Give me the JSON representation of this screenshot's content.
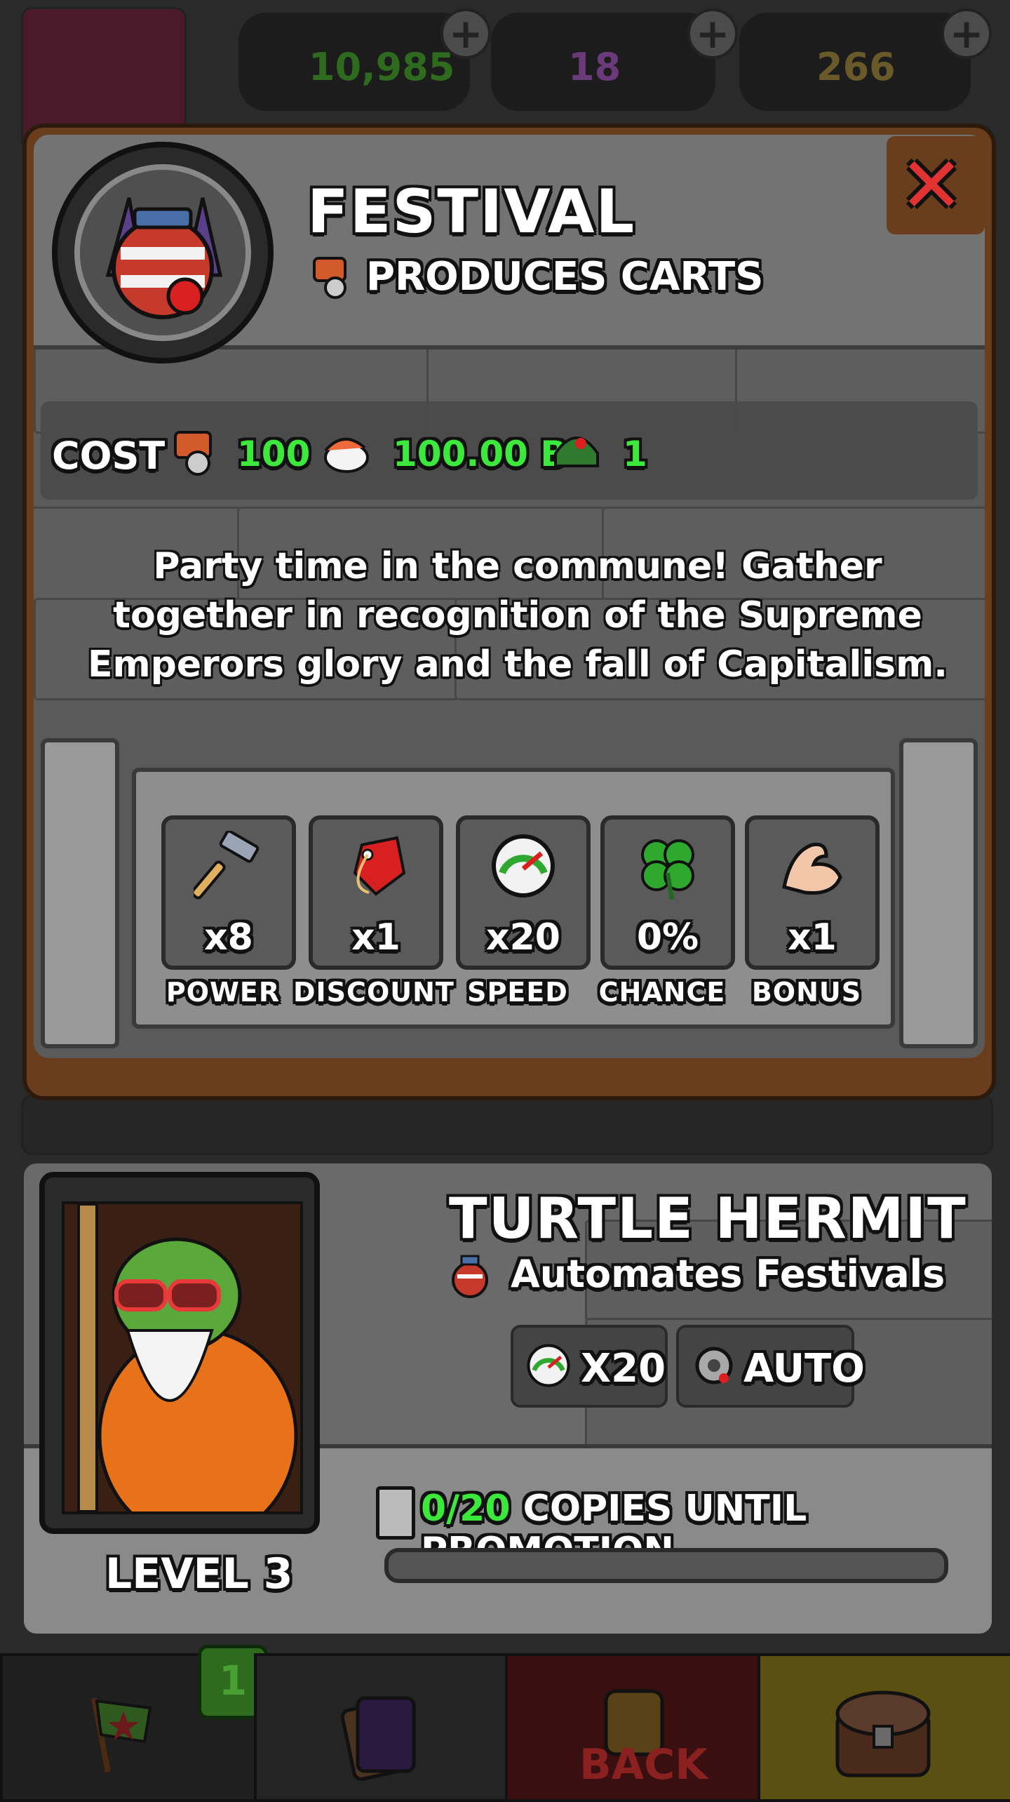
{
  "topbar": {
    "resources": [
      {
        "value": "10,985",
        "icon": "cash-icon",
        "color": "#2f6b1f"
      },
      {
        "value": "18",
        "icon": "potion-icon",
        "color": "#6a3a7a"
      },
      {
        "value": "266",
        "icon": "gold-bar-icon",
        "color": "#6a5a2a"
      }
    ]
  },
  "building": {
    "title": "FESTIVAL",
    "subtitle": "PRODUCES CARTS",
    "cost_label": "COST",
    "costs": [
      {
        "icon": "cart-icon",
        "value": "100"
      },
      {
        "icon": "sushi-icon",
        "value": "100.00 B"
      },
      {
        "icon": "soldier-helmet-icon",
        "value": "1"
      }
    ],
    "description": "Party time in the commune! Gather together in recognition of the Supreme Emperors glory and the fall of Capitalism.",
    "stats": [
      {
        "icon": "hammer-icon",
        "value": "x8",
        "label": "POWER"
      },
      {
        "icon": "price-tag-icon",
        "value": "x1",
        "label": "DISCOUNT"
      },
      {
        "icon": "speedometer-icon",
        "value": "x20",
        "label": "SPEED"
      },
      {
        "icon": "clover-icon",
        "value": "0%",
        "label": "CHANCE"
      },
      {
        "icon": "bicep-icon",
        "value": "x1",
        "label": "BONUS"
      }
    ]
  },
  "manager": {
    "name": "TURTLE HERMIT",
    "description": "Automates Festivals",
    "level": "LEVEL 3",
    "speed": "X20",
    "auto": "AUTO",
    "copies_current": "0/20",
    "copies_label": "COPIES UNTIL PROMOTION",
    "progress": 0
  },
  "nav": {
    "badge_count": "1",
    "back_label": "BACK"
  }
}
